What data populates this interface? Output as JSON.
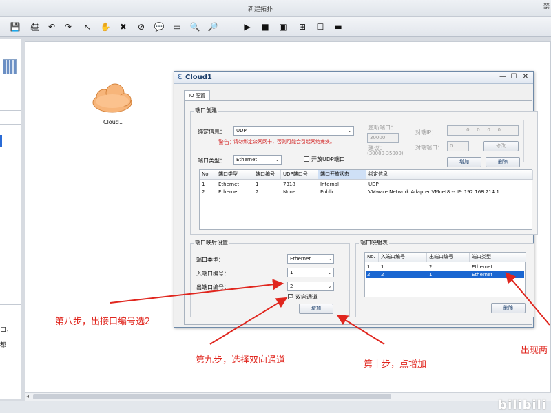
{
  "window": {
    "title": "新建拓扑",
    "corner_text": "禁"
  },
  "toolbar": {
    "buttons": [
      {
        "name": "save-icon",
        "glyph": "💾"
      },
      {
        "name": "print-icon",
        "glyph": "🖨"
      },
      {
        "name": "undo-icon",
        "glyph": "↶"
      },
      {
        "name": "redo-icon",
        "glyph": "↷"
      },
      {
        "name": "pointer-icon",
        "glyph": "↖"
      },
      {
        "name": "hand-icon",
        "glyph": "✋"
      },
      {
        "name": "delete-icon",
        "glyph": "✖"
      },
      {
        "name": "delete-link-icon",
        "glyph": "⊘"
      },
      {
        "name": "text-note-icon",
        "glyph": "💬"
      },
      {
        "name": "rectangle-icon",
        "glyph": "▭"
      },
      {
        "name": "zoom-in-icon",
        "glyph": "🔍"
      },
      {
        "name": "zoom-out-icon",
        "glyph": "🔎"
      },
      {
        "name": "start-icon",
        "glyph": "▶"
      },
      {
        "name": "stop-icon",
        "glyph": "■"
      },
      {
        "name": "capture-icon",
        "glyph": "▣"
      },
      {
        "name": "grid-icon",
        "glyph": "⊞"
      },
      {
        "name": "window-icon",
        "glyph": "☐"
      },
      {
        "name": "console-icon",
        "glyph": "▬"
      }
    ]
  },
  "left_panel": {
    "text_lines": [
      "口，",
      "都"
    ]
  },
  "canvas": {
    "device_label": "Cloud1"
  },
  "dialog": {
    "title": "Cloud1",
    "controls": {
      "minimize": "—",
      "maximize": "☐",
      "close": "✕"
    },
    "tab": "IO 配置",
    "port_create": {
      "group_title": "端口创建",
      "bind_info_label": "绑定信息：",
      "bind_info_value": "UDP",
      "warning_label": "警告：",
      "warning_text": "请勿绑定公网网卡，否则可能会引起网络瘫痪。",
      "port_type_label": "端口类型：",
      "port_type_value": "Ethernet",
      "open_udp_label": "开放UDP端口",
      "listen_port_label": "监听端口：",
      "listen_port_value": "30000",
      "suggest_label": "建议：",
      "suggest_range": "(30000-35000)",
      "peer_ip_label": "对端IP：",
      "peer_ip_value": "0 . 0 . 0 . 0",
      "peer_port_label": "对端端口：",
      "peer_port_value": "0",
      "modify_button": "修改",
      "add_button": "增加",
      "delete_button": "删除",
      "table": {
        "headers": [
          "No.",
          "端口类型",
          "端口编号",
          "UDP端口号",
          "端口开放状态",
          "绑定信息"
        ],
        "rows": [
          [
            "1",
            "Ethernet",
            "1",
            "7318",
            "Internal",
            "UDP"
          ],
          [
            "2",
            "Ethernet",
            "2",
            "None",
            "Public",
            "VMware Network Adapter VMnet8 -- IP: 192.168.214.1"
          ]
        ]
      }
    },
    "mapping_settings": {
      "group_title": "端口映射设置",
      "port_type_label": "端口类型：",
      "port_type_value": "Ethernet",
      "in_port_label": "入端口编号：",
      "in_port_value": "1",
      "out_port_label": "出端口编号：",
      "out_port_value": "2",
      "bidirectional_label": "双向通道",
      "bidirectional_checked": "☑",
      "add_button": "增加"
    },
    "mapping_table": {
      "group_title": "端口映射表",
      "headers": [
        "No.",
        "入端口编号",
        "出端口编号",
        "端口类型"
      ],
      "rows": [
        [
          "1",
          "1",
          "2",
          "Ethernet"
        ],
        [
          "2",
          "2",
          "1",
          "Ethernet"
        ]
      ],
      "delete_button": "删除"
    }
  },
  "annotations": {
    "step8": "第八步，出接口编号选2",
    "step9": "第九步，选择双向通道",
    "step10": "第十步，点增加",
    "result": "出现两"
  },
  "watermark": "bilibili",
  "colors": {
    "annotation_red": "#e0261e",
    "selection_blue": "#1a66d1"
  }
}
